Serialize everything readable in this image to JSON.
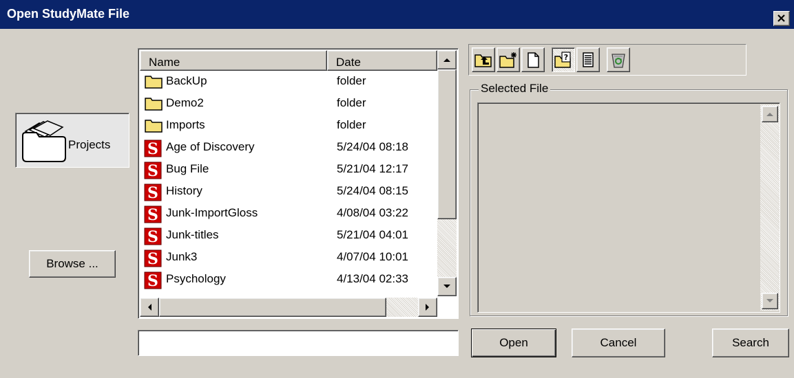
{
  "window": {
    "title": "Open StudyMate File"
  },
  "sidebar": {
    "projects_label": "Projects",
    "browse_label": "Browse ..."
  },
  "filelist": {
    "columns": [
      "Name",
      "Date"
    ],
    "rows": [
      {
        "name": "BackUp",
        "date": "folder",
        "type": "folder"
      },
      {
        "name": "Demo2",
        "date": "folder",
        "type": "folder"
      },
      {
        "name": "Imports",
        "date": "folder",
        "type": "folder"
      },
      {
        "name": "Age of Discovery",
        "date": "5/24/04  08:18",
        "type": "file"
      },
      {
        "name": "Bug File",
        "date": "5/21/04  12:17",
        "type": "file"
      },
      {
        "name": "History",
        "date": "5/24/04  08:15",
        "type": "file"
      },
      {
        "name": "Junk-ImportGloss",
        "date": "4/08/04  03:22",
        "type": "file"
      },
      {
        "name": "Junk-titles",
        "date": "5/21/04  04:01",
        "type": "file"
      },
      {
        "name": "Junk3",
        "date": "4/07/04  10:01",
        "type": "file"
      },
      {
        "name": "Psychology",
        "date": "4/13/04  02:33",
        "type": "file"
      }
    ]
  },
  "filename_input": {
    "value": ""
  },
  "selected_file": {
    "label": "Selected File"
  },
  "toolbar": {
    "icons": [
      "up-folder-icon",
      "new-folder-icon",
      "new-file-icon",
      "open-folder-help-icon",
      "details-view-icon",
      "recycle-bin-icon"
    ]
  },
  "actions": {
    "open_label": "Open",
    "cancel_label": "Cancel",
    "search_label": "Search"
  },
  "colors": {
    "titlebar": "#0a246a",
    "face": "#d4d0c8",
    "file_icon_red": "#cc0000",
    "folder_yellow": "#f5e07a"
  }
}
